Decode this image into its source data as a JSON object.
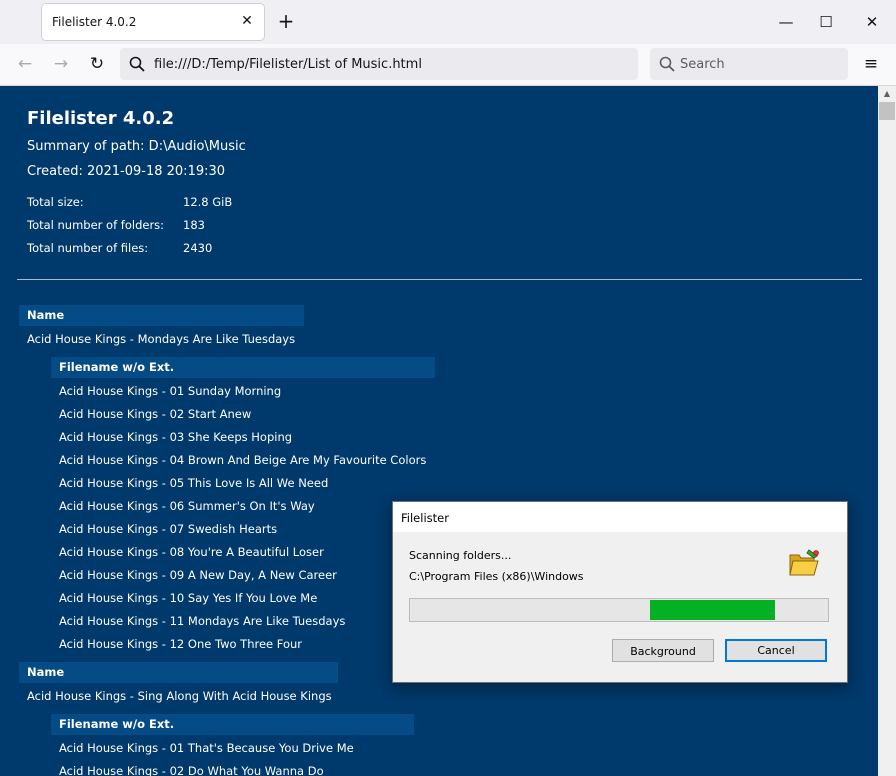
{
  "browser": {
    "tab_title": "Filelister 4.0.2",
    "tab_close": "✕",
    "new_tab": "+",
    "window_minimize": "—",
    "window_maximize": "☐",
    "window_close": "✕",
    "back": "←",
    "forward": "→",
    "reload": "↻",
    "url": "file:///D:/Temp/Filelister/List of Music.html",
    "search_placeholder": "Search",
    "menu": "≡"
  },
  "page": {
    "title": "Filelister 4.0.2",
    "summary_path": "Summary of path: D:\\Audio\\Music",
    "created": "Created: 2021-09-18 20:19:30",
    "stats": [
      {
        "label": "Total size:",
        "value": "12.8 GiB"
      },
      {
        "label": "Total number of folders:",
        "value": "183"
      },
      {
        "label": "Total number of files:",
        "value": "2430"
      }
    ],
    "groups": [
      {
        "name_header": "Name",
        "album": "Acid House Kings - Mondays Are Like Tuesdays",
        "files_header": "Filename w/o Ext.",
        "tracks": [
          "Acid House Kings - 01 Sunday Morning",
          "Acid House Kings - 02 Start Anew",
          "Acid House Kings - 03 She Keeps Hoping",
          "Acid House Kings - 04 Brown And Beige Are My Favourite Colors",
          "Acid House Kings - 05 This Love Is All We Need",
          "Acid House Kings - 06 Summer's On It's Way",
          "Acid House Kings - 07 Swedish Hearts",
          "Acid House Kings - 08 You're A Beautiful Loser",
          "Acid House Kings - 09 A New Day, A New Career",
          "Acid House Kings - 10 Say Yes If You Love Me",
          "Acid House Kings - 11 Mondays Are Like Tuesdays",
          "Acid House Kings - 12 One Two Three Four"
        ]
      },
      {
        "name_header": "Name",
        "album": "Acid House Kings - Sing Along With Acid House Kings",
        "files_header": "Filename w/o Ext.",
        "tracks": [
          "Acid House Kings - 01 That's Because You Drive Me",
          "Acid House Kings - 02 Do What You Wanna Do"
        ]
      }
    ]
  },
  "dialog": {
    "title": "Filelister",
    "status": "Scanning folders...",
    "current_path": "C:\\Program Files (x86)\\Windows",
    "progress_start": 0.575,
    "progress_end": 0.875,
    "background_button": "Background",
    "cancel_button": "Cancel"
  },
  "colors": {
    "page_background": "#00396b",
    "header_background": "#054b86",
    "progress_fill": "#06b025",
    "default_button_border": "#0078d7"
  },
  "icons": {
    "url_icon": "search-icon",
    "search_icon": "search-icon",
    "dialog_icon": "folder-icon"
  }
}
